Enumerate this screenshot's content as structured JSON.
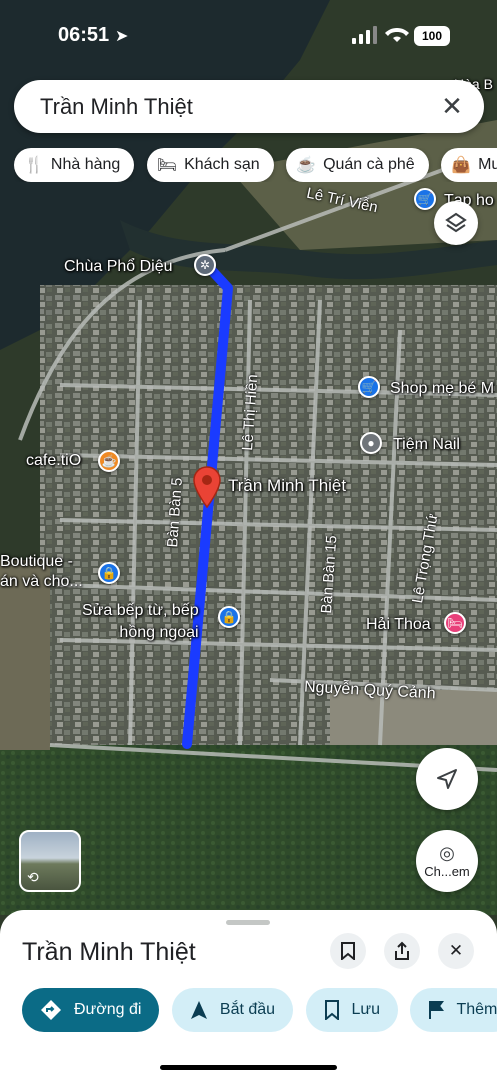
{
  "status_bar": {
    "time": "06:51",
    "battery": "100"
  },
  "search": {
    "query": "Trần Minh Thiệt"
  },
  "chips": [
    {
      "icon": "restaurant-icon",
      "label": "Nhà hàng"
    },
    {
      "icon": "hotel-icon",
      "label": "Khách sạn"
    },
    {
      "icon": "cafe-icon",
      "label": "Quán cà phê"
    },
    {
      "icon": "shopping-icon",
      "label": "Mua"
    }
  ],
  "map": {
    "places": {
      "chua": "Chùa Phổ Diệu",
      "cafe": "cafe.tiO",
      "pin": "Trần Minh Thiệt",
      "shop": "Shop mẹ bé M",
      "nail": "Tiệm Nail",
      "boutique": "Boutique -\nán và cho...",
      "stove": "Sửa bếp từ, bếp\nhồng ngoại",
      "hai_thoa": "Hải Thoa",
      "tap_hoa": "Tạp ho",
      "hoa_b": "Hòa B"
    },
    "streets": {
      "le_tri_vien": "Lê Trí Viễn",
      "le_thi_hien": "Lê Thị Hiền",
      "ban_ban_5": "Bàn Bàn 5",
      "ban_ban_15": "Bàn Bàn 15",
      "le_trong_thu": "Lê Trọng Thứ",
      "nguyen_quy_canh": "Nguyễn Quý Cảnh",
      "tran_minh_partial": "Trần"
    },
    "explore_label": "Ch...em"
  },
  "sheet": {
    "title": "Trần Minh Thiệt",
    "actions": [
      {
        "icon": "directions-icon",
        "label": "Đường đi",
        "primary": true
      },
      {
        "icon": "navigate-icon",
        "label": "Bắt đầu"
      },
      {
        "icon": "bookmark-icon",
        "label": "Lưu"
      },
      {
        "icon": "flag-icon",
        "label": "Thêm"
      }
    ]
  },
  "colors": {
    "route": "#1a3bff",
    "pin": "#ea4335",
    "primary": "#0b6b86"
  }
}
